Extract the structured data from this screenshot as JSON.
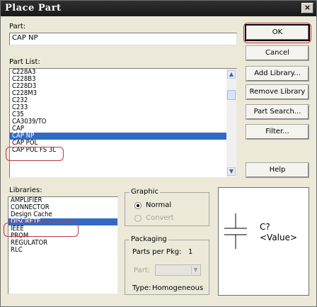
{
  "window": {
    "title": "Place Part",
    "close_glyph": "×"
  },
  "part": {
    "label": "Part:",
    "value": "CAP NP"
  },
  "part_list": {
    "label": "Part List:",
    "items": [
      "C228A3",
      "C228B3",
      "C228D3",
      "C228M3",
      "C232",
      "C233",
      "C35",
      "CA3039/TO",
      "CAP",
      "CAP NP",
      "CAP POL",
      "CAP POL FS 3L"
    ],
    "selected": "CAP NP"
  },
  "libraries": {
    "label": "Libraries:",
    "items": [
      "AMPLIFIER",
      "CONNECTOR",
      "Design Cache",
      "DISCRETE",
      "IEEE",
      "PROM",
      "REGULATOR",
      "RLC"
    ],
    "selected": "DISCRETE"
  },
  "graphic": {
    "title": "Graphic",
    "normal": "Normal",
    "convert": "Convert",
    "selected": "Normal"
  },
  "packaging": {
    "title": "Packaging",
    "parts_per_pkg_label": "Parts per Pkg:",
    "parts_per_pkg_value": "1",
    "part_label": "Part:",
    "type_label": "Type:",
    "type_value": "Homogeneous"
  },
  "buttons": {
    "ok": "OK",
    "cancel": "Cancel",
    "add_library": "Add Library...",
    "remove_library": "Remove Library",
    "part_search": "Part Search...",
    "filter": "Filter...",
    "help": "Help"
  },
  "preview": {
    "refdes": "C?",
    "value": "<Value>"
  },
  "annotation_color": "#c0364a",
  "selection_color": "#316ac5"
}
